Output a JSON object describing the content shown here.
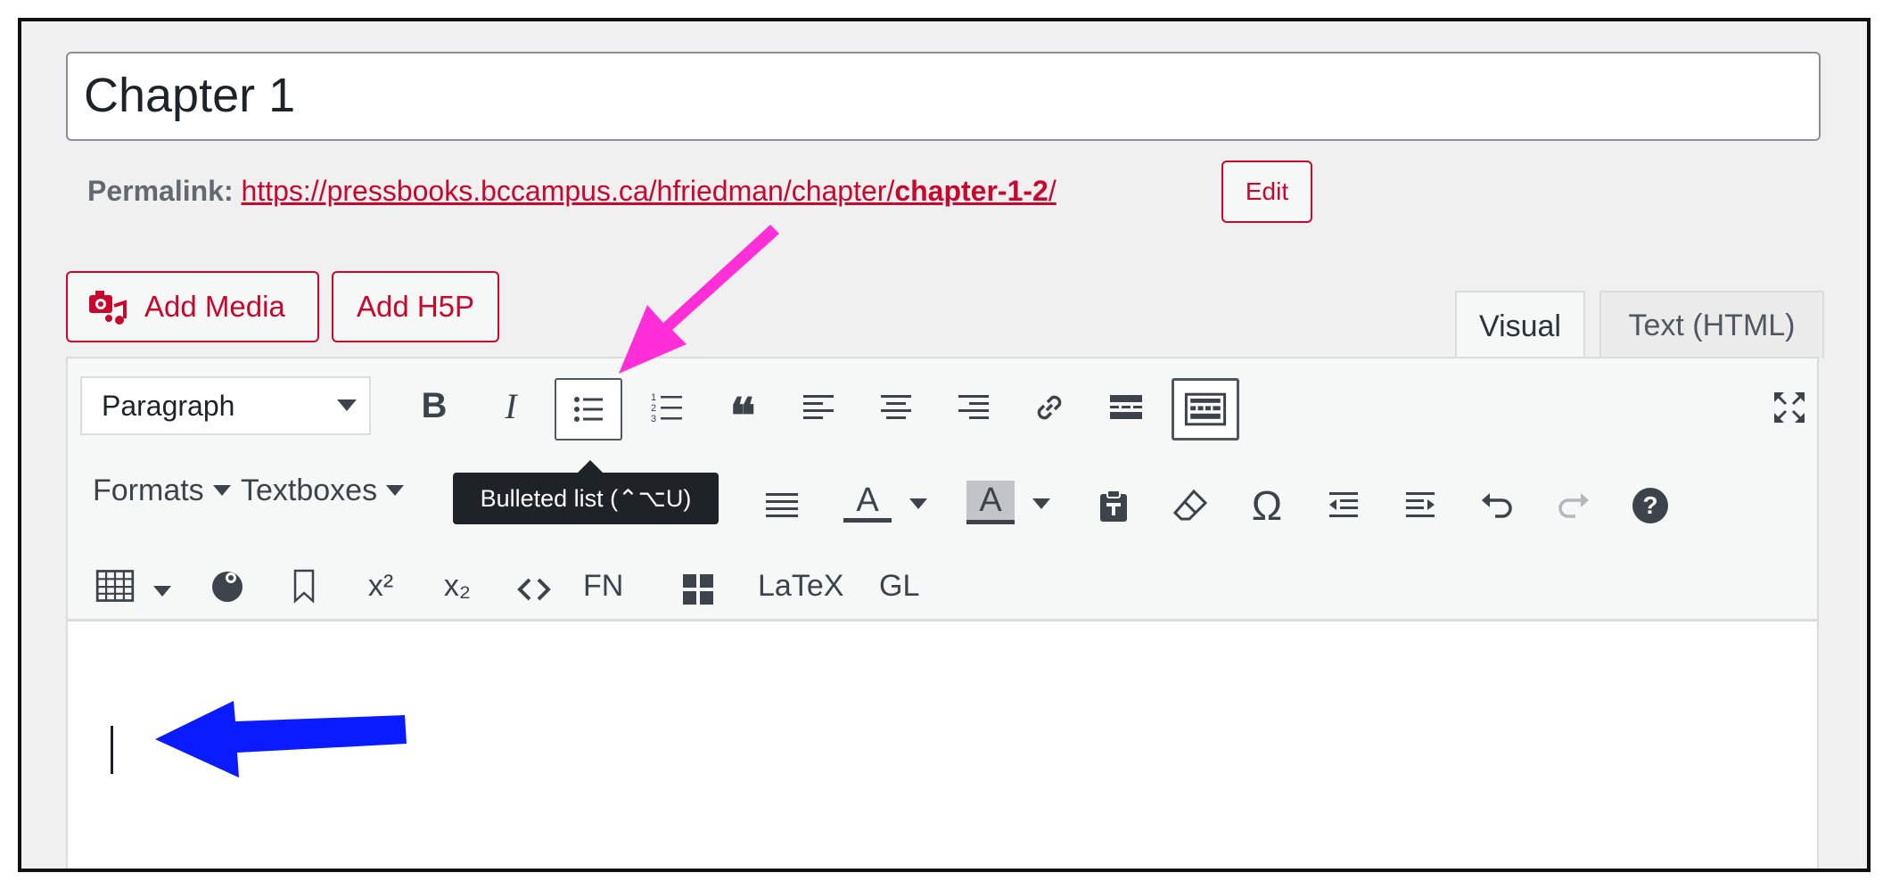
{
  "post": {
    "title": "Chapter 1"
  },
  "permalink": {
    "label": "Permalink:",
    "url_prefix": "https://pressbooks.bccampus.ca/hfriedman/chapter/",
    "slug": "chapter-1-2",
    "url_suffix": "/",
    "edit_label": "Edit"
  },
  "media_buttons": {
    "add_media": "Add Media",
    "add_h5p": "Add H5P"
  },
  "tabs": {
    "visual": "Visual",
    "text": "Text (HTML)"
  },
  "toolbar": {
    "format_select": "Paragraph",
    "formats_menu": "Formats",
    "textboxes_menu": "Textboxes",
    "fn_label": "FN",
    "latex_label": "LaTeX",
    "gl_label": "GL",
    "bold_glyph": "B",
    "italic_glyph": "I",
    "quote_glyph": "❝",
    "omega_glyph": "Ω",
    "help_glyph": "?",
    "text_color_glyph": "A",
    "bg_color_glyph": "A",
    "superscript_glyph": "x²",
    "subscript_glyph": "x₂"
  },
  "tooltip": {
    "text": "Bulleted list (⌃⌥U)"
  },
  "annotations": {
    "pink_arrow_color": "#ff2ed6",
    "blue_arrow_color": "#0a1bff"
  }
}
